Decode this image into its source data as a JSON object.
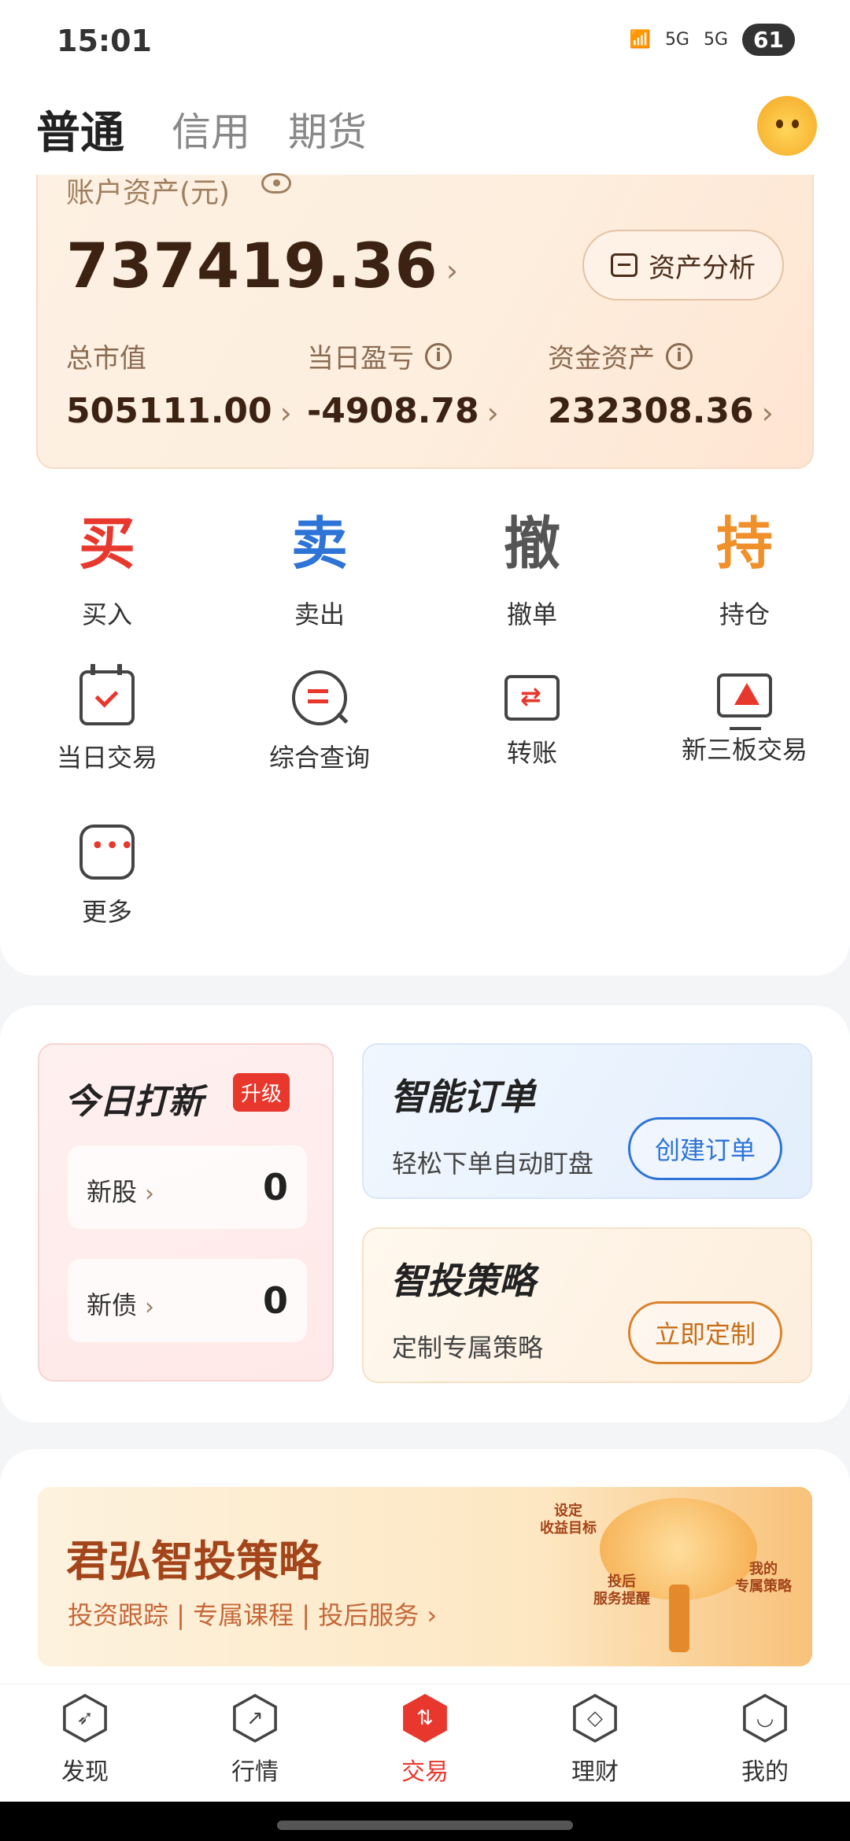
{
  "status": {
    "time": "15:01",
    "signal1": "5G",
    "signal2": "5G",
    "battery": "61"
  },
  "tabs": {
    "normal": "普通",
    "credit": "信用",
    "futures": "期货"
  },
  "account": {
    "label": "账户资产(元)",
    "total": "737419.36",
    "analysis_button": "资产分析",
    "market_value_label": "总市值",
    "market_value": "505111.00",
    "daily_pnl_label": "当日盈亏",
    "daily_pnl": "-4908.78",
    "funds_label": "资金资产",
    "funds": "232308.36"
  },
  "actions": {
    "buy_glyph": "买",
    "buy_label": "买入",
    "sell_glyph": "卖",
    "sell_label": "卖出",
    "cancel_glyph": "撤",
    "cancel_label": "撤单",
    "hold_glyph": "持",
    "hold_label": "持仓"
  },
  "tools": {
    "daily_trade": "当日交易",
    "query": "综合查询",
    "transfer": "转账",
    "new_third_board": "新三板交易",
    "more": "更多"
  },
  "ipo": {
    "title": "今日打新",
    "badge": "升级",
    "stock_label": "新股",
    "stock_value": "0",
    "bond_label": "新债",
    "bond_value": "0"
  },
  "smart_order": {
    "title": "智能订单",
    "subtitle": "轻松下单自动盯盘",
    "button": "创建订单"
  },
  "strategy": {
    "title": "智投策略",
    "subtitle": "定制专属策略",
    "button": "立即定制"
  },
  "banner": {
    "title": "君弘智投策略",
    "subtitle": "投资跟踪 | 专属课程 | 投后服务 ›",
    "note1": "设定\n收益目标",
    "note2": "投后\n服务提醒",
    "note3": "我的\n专属策略"
  },
  "nav": {
    "discover": "发现",
    "market": "行情",
    "trade": "交易",
    "wealth": "理财",
    "mine": "我的"
  },
  "colors": {
    "accent_red": "#e8382d",
    "sell_blue": "#2e74d6",
    "hold_orange": "#f0902b",
    "cancel_gray": "#555555"
  }
}
